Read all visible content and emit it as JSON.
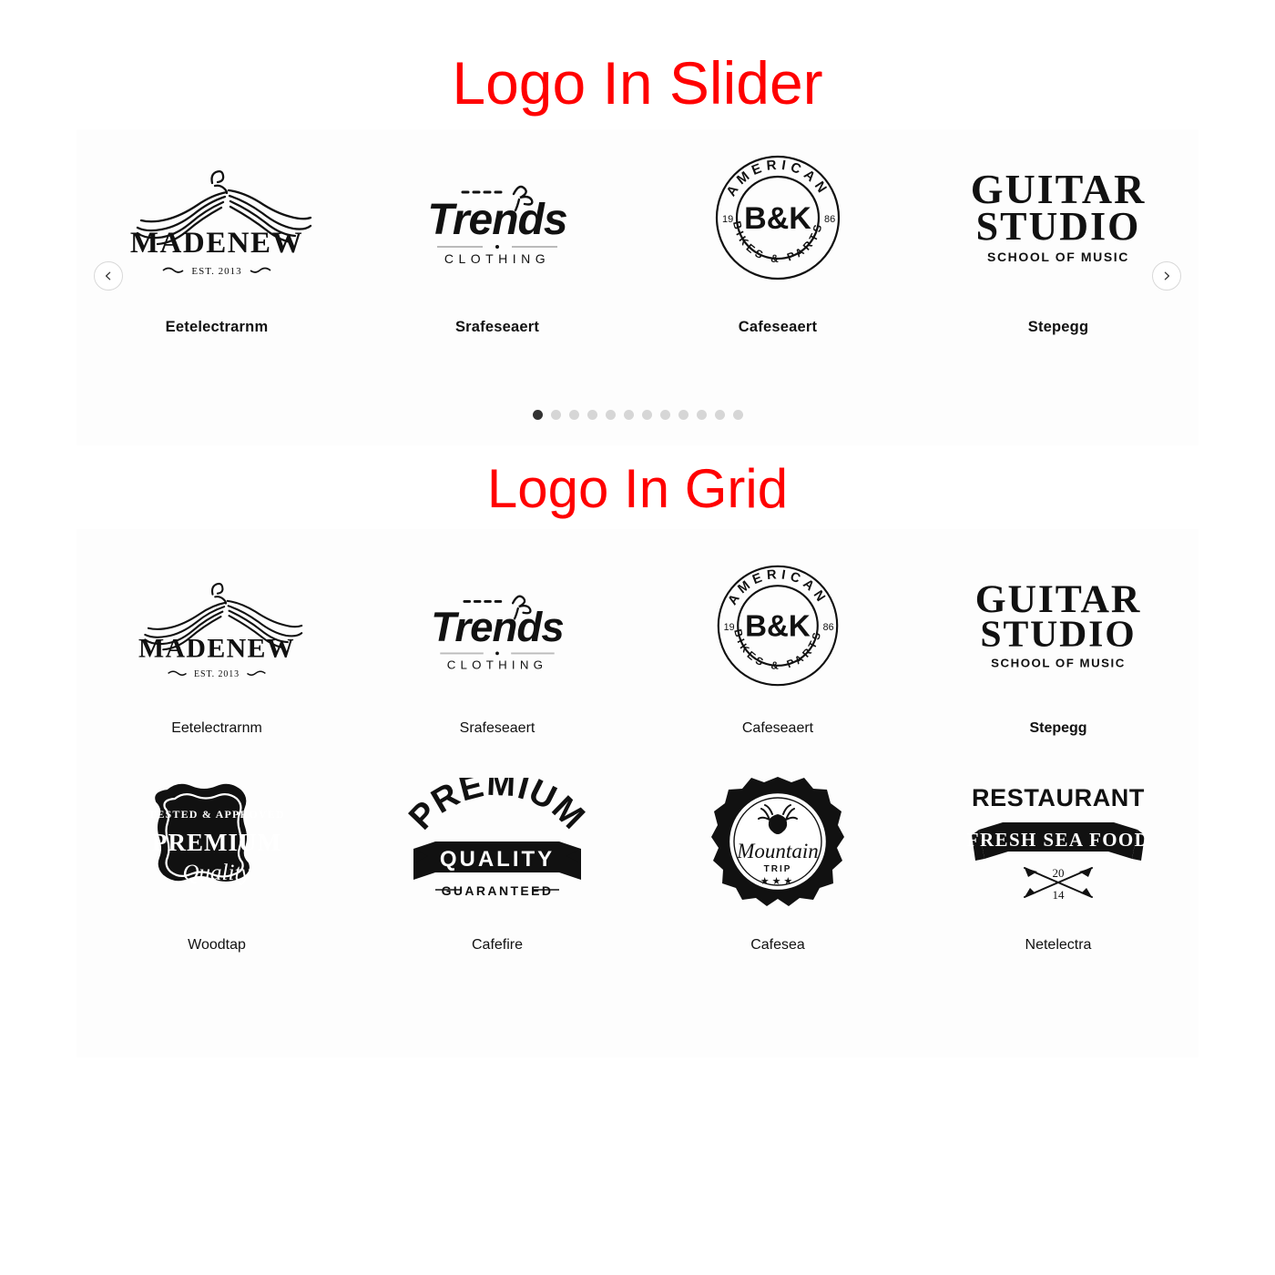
{
  "sections": {
    "slider": {
      "title": "Logo In Slider",
      "title_color": "#ff0000",
      "prev_label": "‹",
      "next_label": "›",
      "active_dot_index": 0,
      "dot_count": 12,
      "slides": [
        {
          "caption": "Eetelectrarnm",
          "logo": "madenew-logo"
        },
        {
          "caption": "Srafeseaert",
          "logo": "trends-clothing-logo"
        },
        {
          "caption": "Cafeseaert",
          "logo": "bk-american-bikes-logo"
        },
        {
          "caption": "Stepegg",
          "logo": "guitar-studio-logo"
        }
      ]
    },
    "grid": {
      "title": "Logo In Grid",
      "title_color": "#ff0000",
      "rows": [
        [
          {
            "caption": "Eetelectrarnm",
            "logo": "madenew-logo",
            "bold": false
          },
          {
            "caption": "Srafeseaert",
            "logo": "trends-clothing-logo",
            "bold": false
          },
          {
            "caption": "Cafeseaert",
            "logo": "bk-american-bikes-logo",
            "bold": false
          },
          {
            "caption": "Stepegg",
            "logo": "guitar-studio-logo",
            "bold": true
          }
        ],
        [
          {
            "caption": "Woodtap",
            "logo": "premium-quality-badge-logo",
            "bold": false
          },
          {
            "caption": "Cafefire",
            "logo": "premium-quality-ribbon-logo",
            "bold": false
          },
          {
            "caption": "Cafesea",
            "logo": "mountain-trip-logo",
            "bold": false
          },
          {
            "caption": "Netelectra",
            "logo": "restaurant-sea-food-logo",
            "bold": false
          }
        ]
      ]
    }
  },
  "logo_text": {
    "madenew": {
      "name": "MADENEW",
      "est": "EST. 2013"
    },
    "trends": {
      "name": "Trends",
      "sub": "CLOTHING"
    },
    "bk": {
      "top": "AMERICAN",
      "bottom": "BIKES & PARTS",
      "center": "B&K",
      "year_left": "19",
      "year_right": "86"
    },
    "guitar": {
      "line1": "GUITAR",
      "line2": "STUDIO",
      "sub": "SCHOOL OF MUSIC"
    },
    "premium_badge": {
      "top": "TESTED & APPROVED",
      "mid": "PREMIUM",
      "bottom": "Quality"
    },
    "premium_ribbon": {
      "top": "PREMIUM",
      "mid": "QUALITY",
      "bottom": "GUARANTEED"
    },
    "mountain": {
      "name": "Mountain",
      "sub": "TRIP",
      "stars": "★★★"
    },
    "restaurant": {
      "top": "RESTAURANT",
      "mid": "FRESH SEA FOOD",
      "year_top": "20",
      "year_bottom": "14"
    }
  },
  "colors": {
    "title_red": "#ff0000",
    "panel_bg": "#fdfdfd",
    "page_bg": "#ffffff",
    "ink": "#111111",
    "dot_inactive": "#d6d6d6",
    "dot_active": "#333333"
  }
}
